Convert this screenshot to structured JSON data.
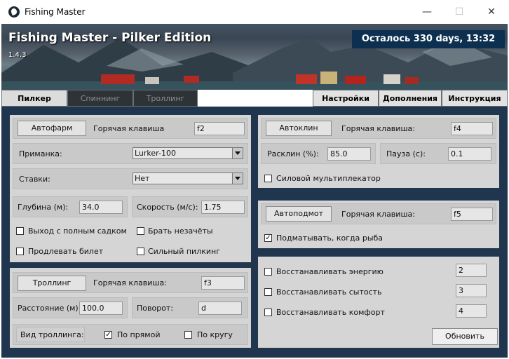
{
  "window": {
    "title": "Fishing Master",
    "min_glyph": "—",
    "max_glyph": "☐",
    "close_glyph": "✕"
  },
  "banner": {
    "title": "Fishing Master - Pilker Edition",
    "version": "1.4.3",
    "remaining": "Осталось 330 days, 13:32"
  },
  "tabs_left": [
    {
      "label": "Пилкер",
      "state": "active"
    },
    {
      "label": "Спиннинг",
      "state": "inactive"
    },
    {
      "label": "Троллинг",
      "state": "inactive"
    }
  ],
  "tabs_right": [
    {
      "label": "Настройки"
    },
    {
      "label": "Дополнения"
    },
    {
      "label": "Инструкция"
    }
  ],
  "autofarm": {
    "button": "Автофарм",
    "hotkey_label": "Горячая клавиша",
    "hotkey_value": "f2"
  },
  "bait": {
    "label": "Приманка:",
    "value": "Lurker-100"
  },
  "bets": {
    "label": "Ставки:",
    "value": "Нет"
  },
  "depth": {
    "label": "Глубина (м):",
    "value": "34.0"
  },
  "speed": {
    "label": "Скорость (м/с):",
    "value": "1.75"
  },
  "options": {
    "exit_full": {
      "label": "Выход с полным садком",
      "checked": false
    },
    "take_misses": {
      "label": "Брать незачёты",
      "checked": false
    },
    "extend_ticket": {
      "label": "Продлевать билет",
      "checked": false
    },
    "strong_pilking": {
      "label": "Сильный пилкинг",
      "checked": false
    }
  },
  "trolling": {
    "button": "Троллинг",
    "hotkey_label": "Горячая клавиша:",
    "hotkey_value": "f3",
    "distance_label": "Расстояние (м):",
    "distance_value": "100.0",
    "turn_label": "Поворот:",
    "turn_value": "d",
    "type_label": "Вид троллинга:",
    "straight_label": "По прямой",
    "straight_checked": true,
    "circle_label": "По кругу",
    "circle_checked": false
  },
  "autoclean": {
    "button": "Автоклин",
    "hotkey_label": "Горячая клавиша:",
    "hotkey_value": "f4",
    "raskl_label": "Расклин (%):",
    "raskl_value": "85.0",
    "pause_label": "Пауза (с):",
    "pause_value": "0.1",
    "multiplier_label": "Силовой мультиплекатор",
    "multiplier_checked": false
  },
  "autoreel": {
    "button": "Автоподмот",
    "hotkey_label": "Горячая клавиша:",
    "hotkey_value": "f5",
    "reel_label": "Подматывать, когда рыба",
    "reel_checked": true
  },
  "restore": {
    "energy_label": "Восстанавливать энергию",
    "energy_value": "2",
    "energy_checked": false,
    "satiety_label": "Восстанавливать сытость",
    "satiety_value": "3",
    "satiety_checked": false,
    "comfort_label": "Восстанавливать комфорт",
    "comfort_value": "4",
    "comfort_checked": false,
    "update_button": "Обновить"
  },
  "colors": {
    "panel_bg": "#d5d5d5",
    "main_bg": "#20364e",
    "remaining_bg": "#0e3050"
  }
}
